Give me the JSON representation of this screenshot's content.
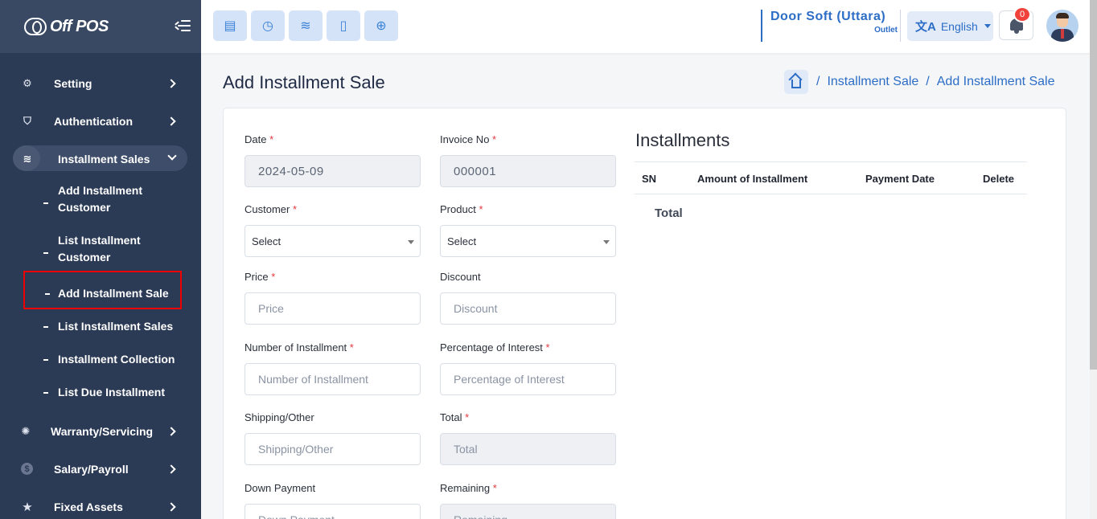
{
  "app": {
    "logo_text": "Off POS"
  },
  "sidebar": {
    "items": [
      {
        "label": "Setting",
        "icon": "gear-icon"
      },
      {
        "label": "Authentication",
        "icon": "shield-icon"
      },
      {
        "label": "Installment Sales",
        "icon": "layers-icon",
        "open": true
      },
      {
        "label": "Warranty/Servicing",
        "icon": "bulb-icon"
      },
      {
        "label": "Salary/Payroll",
        "icon": "dollar-icon"
      },
      {
        "label": "Fixed Assets",
        "icon": "star-icon"
      }
    ],
    "sub_items": [
      {
        "label_line1": "Add Installment",
        "label_line2": "Customer"
      },
      {
        "label_line1": "List Installment",
        "label_line2": "Customer"
      },
      {
        "label": "Add Installment Sale",
        "active": true
      },
      {
        "label": "List Installment Sales"
      },
      {
        "label": "Installment Collection"
      },
      {
        "label": "List Due Installment"
      }
    ]
  },
  "topbar": {
    "quick_buttons": [
      "pos-icon",
      "clock-icon",
      "layers-icon",
      "calculator-icon",
      "target-icon"
    ],
    "outlet_name": "Door Soft (Uttara)",
    "outlet_type": "Outlet",
    "language": "English",
    "notification_count": "0"
  },
  "page": {
    "title": "Add Installment Sale",
    "breadcrumb": [
      "Installment Sale",
      "Add Installment Sale"
    ]
  },
  "form": {
    "date": {
      "label": "Date",
      "value": "2024-05-09"
    },
    "invoice": {
      "label": "Invoice No",
      "value": "000001"
    },
    "customer": {
      "label": "Customer",
      "value": "Select"
    },
    "product": {
      "label": "Product",
      "value": "Select"
    },
    "price": {
      "label": "Price",
      "placeholder": "Price"
    },
    "discount": {
      "label": "Discount",
      "placeholder": "Discount"
    },
    "num_installment": {
      "label": "Number of Installment",
      "placeholder": "Number of Installment"
    },
    "interest": {
      "label": "Percentage of Interest",
      "placeholder": "Percentage of Interest"
    },
    "shipping": {
      "label": "Shipping/Other",
      "placeholder": "Shipping/Other"
    },
    "total": {
      "label": "Total",
      "placeholder": "Total"
    },
    "down_payment": {
      "label": "Down Payment",
      "placeholder": "Down Payment"
    },
    "remaining": {
      "label": "Remaining",
      "placeholder": "Remaining"
    },
    "required_mark": "*"
  },
  "installments": {
    "title": "Installments",
    "columns": [
      "SN",
      "Amount of Installment",
      "Payment Date",
      "Delete"
    ],
    "total_label": "Total"
  },
  "colors": {
    "sidebar": "#2b3a55",
    "accent": "#2c6dc6",
    "required": "#e0393e",
    "highlight": "#ee0000"
  }
}
